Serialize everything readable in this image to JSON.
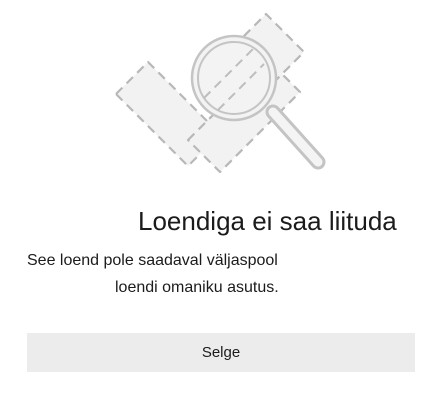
{
  "dialog": {
    "illustration_icon": "dashed-list-with-magnifier-icon",
    "title": "Loendiga ei saa liituda",
    "message_line1": "See loend pole saadaval väljaspool",
    "message_line2": "loendi omaniku asutus.",
    "button_label": "Selge"
  },
  "colors": {
    "illustration_stroke": "#bdbdbd",
    "illustration_fill": "#f0f0f0",
    "button_background": "#ececec",
    "text": "#1b1b1b"
  }
}
